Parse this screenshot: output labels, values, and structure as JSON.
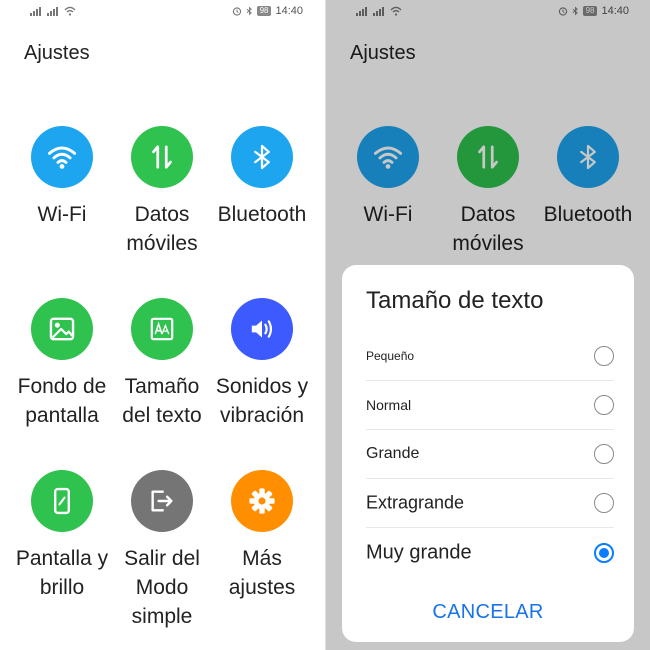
{
  "status": {
    "time": "14:40",
    "battery": "98"
  },
  "header": {
    "title": "Ajustes"
  },
  "tiles": [
    {
      "label": "Wi-Fi",
      "color": "#1ea5f0",
      "icon": "wifi-icon"
    },
    {
      "label": "Datos móviles",
      "color": "#2fc24f",
      "icon": "mobile-data-icon"
    },
    {
      "label": "Bluetooth",
      "color": "#1ea5f0",
      "icon": "bluetooth-icon"
    },
    {
      "label": "Fondo de pantalla",
      "color": "#2fc24f",
      "icon": "wallpaper-icon"
    },
    {
      "label": "Tamaño del texto",
      "color": "#2fc24f",
      "icon": "text-size-icon"
    },
    {
      "label": "Sonidos y vibración",
      "color": "#3d5afe",
      "icon": "volume-icon"
    },
    {
      "label": "Pantalla y brillo",
      "color": "#2fc24f",
      "icon": "display-icon"
    },
    {
      "label": "Salir del Modo simple",
      "color": "#757575",
      "icon": "exit-icon"
    },
    {
      "label": "Más ajustes",
      "color": "#ff8f00",
      "icon": "gear-icon"
    }
  ],
  "dialog": {
    "title": "Tamaño de texto",
    "options": [
      {
        "label": "Pequeño",
        "selected": false
      },
      {
        "label": "Normal",
        "selected": false
      },
      {
        "label": "Grande",
        "selected": false
      },
      {
        "label": "Extragrande",
        "selected": false
      },
      {
        "label": "Muy grande",
        "selected": true
      }
    ],
    "cancel_label": "CANCELAR"
  },
  "colors": {
    "accent": "#1a73e8",
    "radio_selected": "#0a7cff"
  }
}
